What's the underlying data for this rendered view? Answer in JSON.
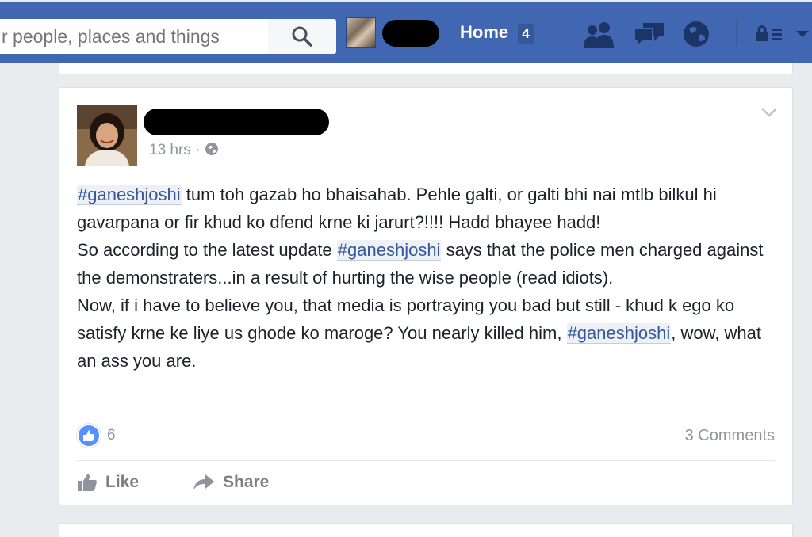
{
  "search": {
    "placeholder": "r people, places and things",
    "icon": "magnifier"
  },
  "nav": {
    "home_label": "Home",
    "home_badge": "4",
    "icons": [
      "friends-icon",
      "messages-icon",
      "globe-icon",
      "privacy-lock-icon",
      "account-menu-icon"
    ],
    "colors": {
      "bar": "#4267b2",
      "text": "#ffffff"
    }
  },
  "post": {
    "time": "13 hrs",
    "separator": "·",
    "audience_icon": "globe-icon",
    "body": {
      "line1_tag": "#ganeshjoshi",
      "line1_text": " tum toh gazab ho bhaisahab. Pehle galti, or galti bhi nai mtlb bilkul hi gavarpana or fir khud ko dfend krne ki jarurt?!!!! Hadd bhayee hadd!",
      "line2_pre": "So according to the latest update ",
      "line2_tag": "#ganeshjoshi",
      "line2_post": " says that the police men charged against the demonstraters...in a result of hurting the wise people (read idiots).",
      "line3_text": "Now, if i have to believe you, that media is portraying you bad but still - khud k ego ko satisfy krne ke liye us ghode ko maroge? You nearly killed him, ",
      "line3_tag": "#ganeshjoshi",
      "line3_post": ", wow, what an ass you are."
    },
    "reactions": {
      "like_count": "6",
      "comments": "3 Comments"
    },
    "actions": {
      "like": "Like",
      "share": "Share"
    }
  }
}
